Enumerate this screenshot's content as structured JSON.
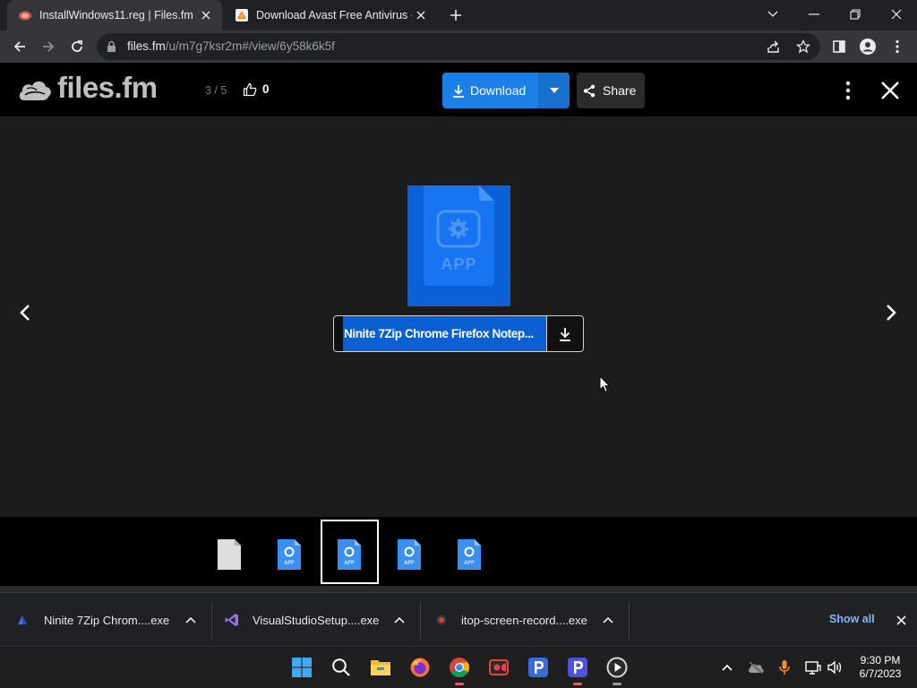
{
  "browser": {
    "tabs": [
      {
        "title": "InstallWindows11.reg | Files.fm",
        "active": true
      },
      {
        "title": "Download Avast Free Antivirus - ",
        "active": false
      }
    ],
    "new_tab_label": "+",
    "url_host": "files.fm",
    "url_path": "/u/m7g7ksr2m#/view/6y58k6k5f"
  },
  "filesfm": {
    "logo": "files.fm",
    "counter": "3 / 5",
    "like_count": "0",
    "download_label": "Download",
    "share_label": "Share",
    "file_name": "Ninite 7Zip Chrome Firefox Notep...",
    "file_type_label": "APP"
  },
  "thumbnails": [
    {
      "type": "generic",
      "label": ""
    },
    {
      "type": "app",
      "label": "APP"
    },
    {
      "type": "app",
      "label": "APP",
      "selected": true
    },
    {
      "type": "app",
      "label": "APP"
    },
    {
      "type": "app",
      "label": "APP"
    }
  ],
  "downloads": [
    {
      "name": "Ninite 7Zip Chrom....exe"
    },
    {
      "name": "VisualStudioSetup....exe"
    },
    {
      "name": "itop-screen-record....exe"
    }
  ],
  "show_all_label": "Show all",
  "taskbar": {
    "time": "9:30 PM",
    "date": "6/7/2023"
  },
  "colors": {
    "accent_blue": "#1a7fe6",
    "file_icon_blue": "#0a60d6",
    "link_blue": "#8ab4f8"
  }
}
